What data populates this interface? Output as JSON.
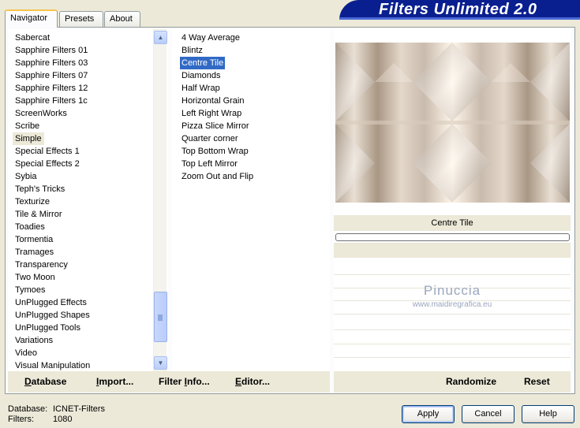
{
  "tabs": [
    {
      "label": "Navigator",
      "active": true
    },
    {
      "label": "Presets",
      "active": false
    },
    {
      "label": "About",
      "active": false
    }
  ],
  "title": "Filters Unlimited 2.0",
  "categories": {
    "items": [
      "Sabercat",
      "Sapphire Filters 01",
      "Sapphire Filters 03",
      "Sapphire Filters 07",
      "Sapphire Filters 12",
      "Sapphire Filters 1c",
      "ScreenWorks",
      "Scribe",
      "Simple",
      "Special Effects 1",
      "Special Effects 2",
      "Sybia",
      "Teph's Tricks",
      "Texturize",
      "Tile & Mirror",
      "Toadies",
      "Tormentia",
      "Tramages",
      "Transparency",
      "Two Moon",
      "Tymoes",
      "UnPlugged Effects",
      "UnPlugged Shapes",
      "UnPlugged Tools",
      "Variations",
      "Video",
      "Visual Manipulation"
    ],
    "selected": "Simple"
  },
  "filters": {
    "items": [
      "4 Way Average",
      "Blintz",
      "Centre Tile",
      "Diamonds",
      "Half Wrap",
      "Horizontal Grain",
      "Left Right Wrap",
      "Pizza Slice Mirror",
      "Quarter corner",
      "Top Bottom Wrap",
      "Top Left Mirror",
      "Zoom Out and Flip"
    ],
    "selected": "Centre Tile"
  },
  "preview": {
    "filter_name": "Centre Tile",
    "progress": 0,
    "watermark_name": "Pinuccia",
    "watermark_url": "www.maidiregrafica.eu"
  },
  "left_buttons": {
    "database": {
      "underlined": "D",
      "rest": "atabase"
    },
    "import": {
      "underlined": "I",
      "rest": "mport..."
    },
    "filter_info": {
      "before": "Filter ",
      "underlined": "I",
      "rest": "nfo..."
    },
    "editor": {
      "underlined": "E",
      "rest": "ditor..."
    }
  },
  "right_buttons": {
    "randomize": "Randomize",
    "reset": "Reset"
  },
  "status": {
    "database_label": "Database:",
    "database_value": "ICNET-Filters",
    "filters_label": "Filters:",
    "filters_value": "1080"
  },
  "dialog_buttons": {
    "apply": "Apply",
    "cancel": "Cancel",
    "help": "Help"
  },
  "colors": {
    "title_bar": "#0a1f8f",
    "selection": "#316ac5",
    "dialog_bg": "#ece9d8"
  }
}
